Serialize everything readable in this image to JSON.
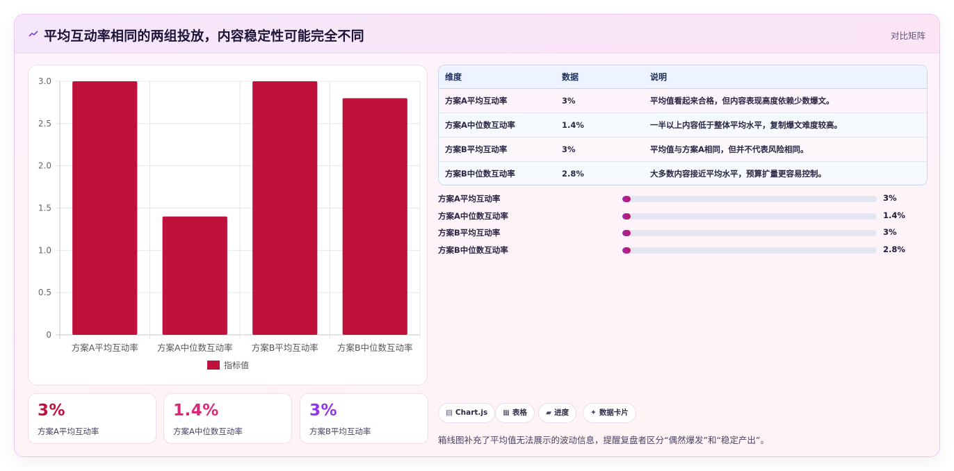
{
  "header": {
    "icon": "trend-icon",
    "title": "平均互动率相同的两组投放，内容稳定性可能完全不同",
    "tag": "对比矩阵"
  },
  "chart_data": {
    "type": "bar",
    "categories": [
      "方案A平均互动率",
      "方案A中位数互动率",
      "方案B平均互动率",
      "方案B中位数互动率"
    ],
    "series": [
      {
        "name": "指标值",
        "values": [
          3,
          1.4,
          3,
          2.8
        ]
      }
    ],
    "ylim": [
      0,
      3
    ],
    "yticks": [
      "0",
      "0.5",
      "1.0",
      "1.5",
      "2.0",
      "2.5",
      "3.0"
    ],
    "legend_position": "bottom",
    "grid": true,
    "bar_color": "#be123c"
  },
  "stats": [
    {
      "value": "3%",
      "label": "方案A平均互动率",
      "color": "#be123c"
    },
    {
      "value": "1.4%",
      "label": "方案A中位数互动率",
      "color": "#db2777"
    },
    {
      "value": "3%",
      "label": "方案B平均互动率",
      "color": "#9333ea"
    }
  ],
  "table": {
    "headers": [
      "维度",
      "数据",
      "说明"
    ],
    "rows": [
      [
        "方案A平均互动率",
        "3%",
        "平均值看起来合格，但内容表现高度依赖少数爆文。"
      ],
      [
        "方案A中位数互动率",
        "1.4%",
        "一半以上内容低于整体平均水平，复制爆文难度较高。"
      ],
      [
        "方案B平均互动率",
        "3%",
        "平均值与方案A相同，但并不代表风险相同。"
      ],
      [
        "方案B中位数互动率",
        "2.8%",
        "大多数内容接近平均水平，预算扩量更容易控制。"
      ]
    ]
  },
  "progress": [
    {
      "label": "方案A平均互动率",
      "value": "3%",
      "fill": 0.03
    },
    {
      "label": "方案A中位数互动率",
      "value": "1.4%",
      "fill": 0.014
    },
    {
      "label": "方案B平均互动率",
      "value": "3%",
      "fill": 0.03
    },
    {
      "label": "方案B中位数互动率",
      "value": "2.8%",
      "fill": 0.028
    }
  ],
  "chips": [
    {
      "icon": "chart-icon",
      "glyph": "▤",
      "label": "Chart.js"
    },
    {
      "icon": "table-icon",
      "glyph": "▦",
      "label": "表格"
    },
    {
      "icon": "progress-icon",
      "glyph": "▰",
      "label": "进度"
    },
    {
      "icon": "card-icon",
      "glyph": "✦",
      "label": "数据卡片"
    }
  ],
  "note": "箱线图补充了平均值无法展示的波动信息，提醒复盘者区分“偶然爆发”和“稳定产出”。"
}
